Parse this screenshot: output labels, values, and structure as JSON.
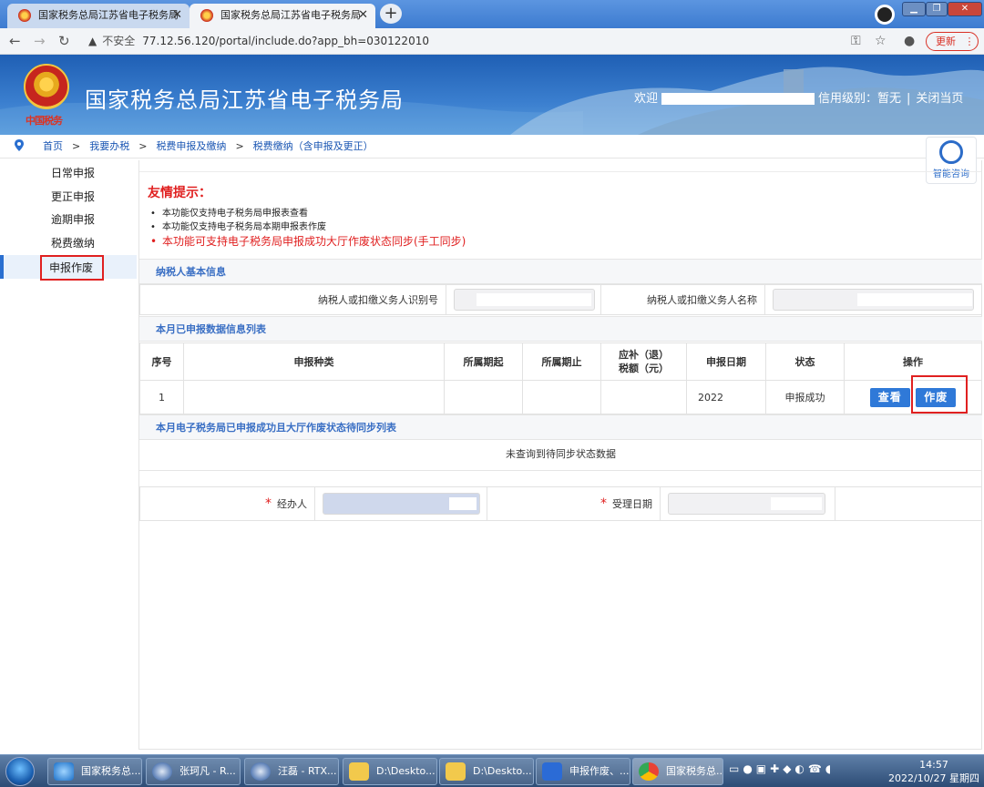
{
  "browser": {
    "tabs": [
      {
        "title": "国家税务总局江苏省电子税务局",
        "active": false
      },
      {
        "title": "国家税务总局江苏省电子税务局",
        "active": true
      }
    ],
    "new_tab_icon": "plus-icon",
    "security_label": "不安全",
    "url": "77.12.56.120/portal/include.do?app_bh=030122010",
    "update_label": "更新"
  },
  "site": {
    "title": "国家税务总局江苏省电子税务局",
    "emblem_text": "中国税务",
    "welcome": "欢迎",
    "credit_label": "信用级别：暂无",
    "close_label": "关闭当页"
  },
  "breadcrumb": [
    "首页",
    "我要办税",
    "税费申报及缴纳",
    "税费缴纳（含申报及更正）"
  ],
  "help": {
    "label": "智能咨询"
  },
  "sidebar": {
    "items": [
      {
        "label": "日常申报",
        "active": false
      },
      {
        "label": "更正申报",
        "active": false
      },
      {
        "label": "逾期申报",
        "active": false
      },
      {
        "label": "税费缴纳",
        "active": false
      },
      {
        "label": "申报作废",
        "active": true
      }
    ]
  },
  "tips": {
    "title": "友情提示：",
    "items": [
      "本功能仅支持电子税务局申报表查看",
      "本功能仅支持电子税务局本期申报表作废",
      "本功能可支持电子税务局申报成功大厅作废状态同步(手工同步)"
    ]
  },
  "taxpayer": {
    "section_title": "纳税人基本信息",
    "id_label": "纳税人或扣缴义务人识别号",
    "name_label": "纳税人或扣缴义务人名称"
  },
  "declared": {
    "section_title": "本月已申报数据信息列表",
    "headers": [
      "序号",
      "申报种类",
      "所属期起",
      "所属期止",
      "应补（退）税额（元）",
      "申报日期",
      "状态",
      "操作"
    ],
    "rows": [
      {
        "index": "1",
        "type": "",
        "start": "",
        "end": "",
        "amount": "",
        "date": "2022",
        "status": "申报成功",
        "view_label": "查看",
        "void_label": "作废"
      }
    ]
  },
  "sync": {
    "section_title": "本月电子税务局已申报成功且大厅作废状态待同步列表",
    "empty_text": "未查询到待同步状态数据"
  },
  "footer_form": {
    "operator_label": "经办人",
    "date_label": "受理日期",
    "required_mark": "*"
  },
  "taskbar": {
    "items": [
      {
        "label": "国家税务总...",
        "icon": "ie-icon"
      },
      {
        "label": "张珂凡 - R...",
        "icon": "rtx-icon"
      },
      {
        "label": "汪磊 - RTX...",
        "icon": "rtx-icon"
      },
      {
        "label": "D:\\Deskto...",
        "icon": "folder-icon"
      },
      {
        "label": "D:\\Deskto...",
        "icon": "folder-icon"
      },
      {
        "label": "申报作废、...",
        "icon": "word-icon"
      },
      {
        "label": "国家税务总...",
        "icon": "chrome-icon"
      }
    ],
    "time": "14:57",
    "date": "2022/10/27 星期四"
  },
  "colors": {
    "brand_blue": "#2f79d8",
    "alert_red": "#e02020",
    "section_blue": "#3a6fc4"
  }
}
